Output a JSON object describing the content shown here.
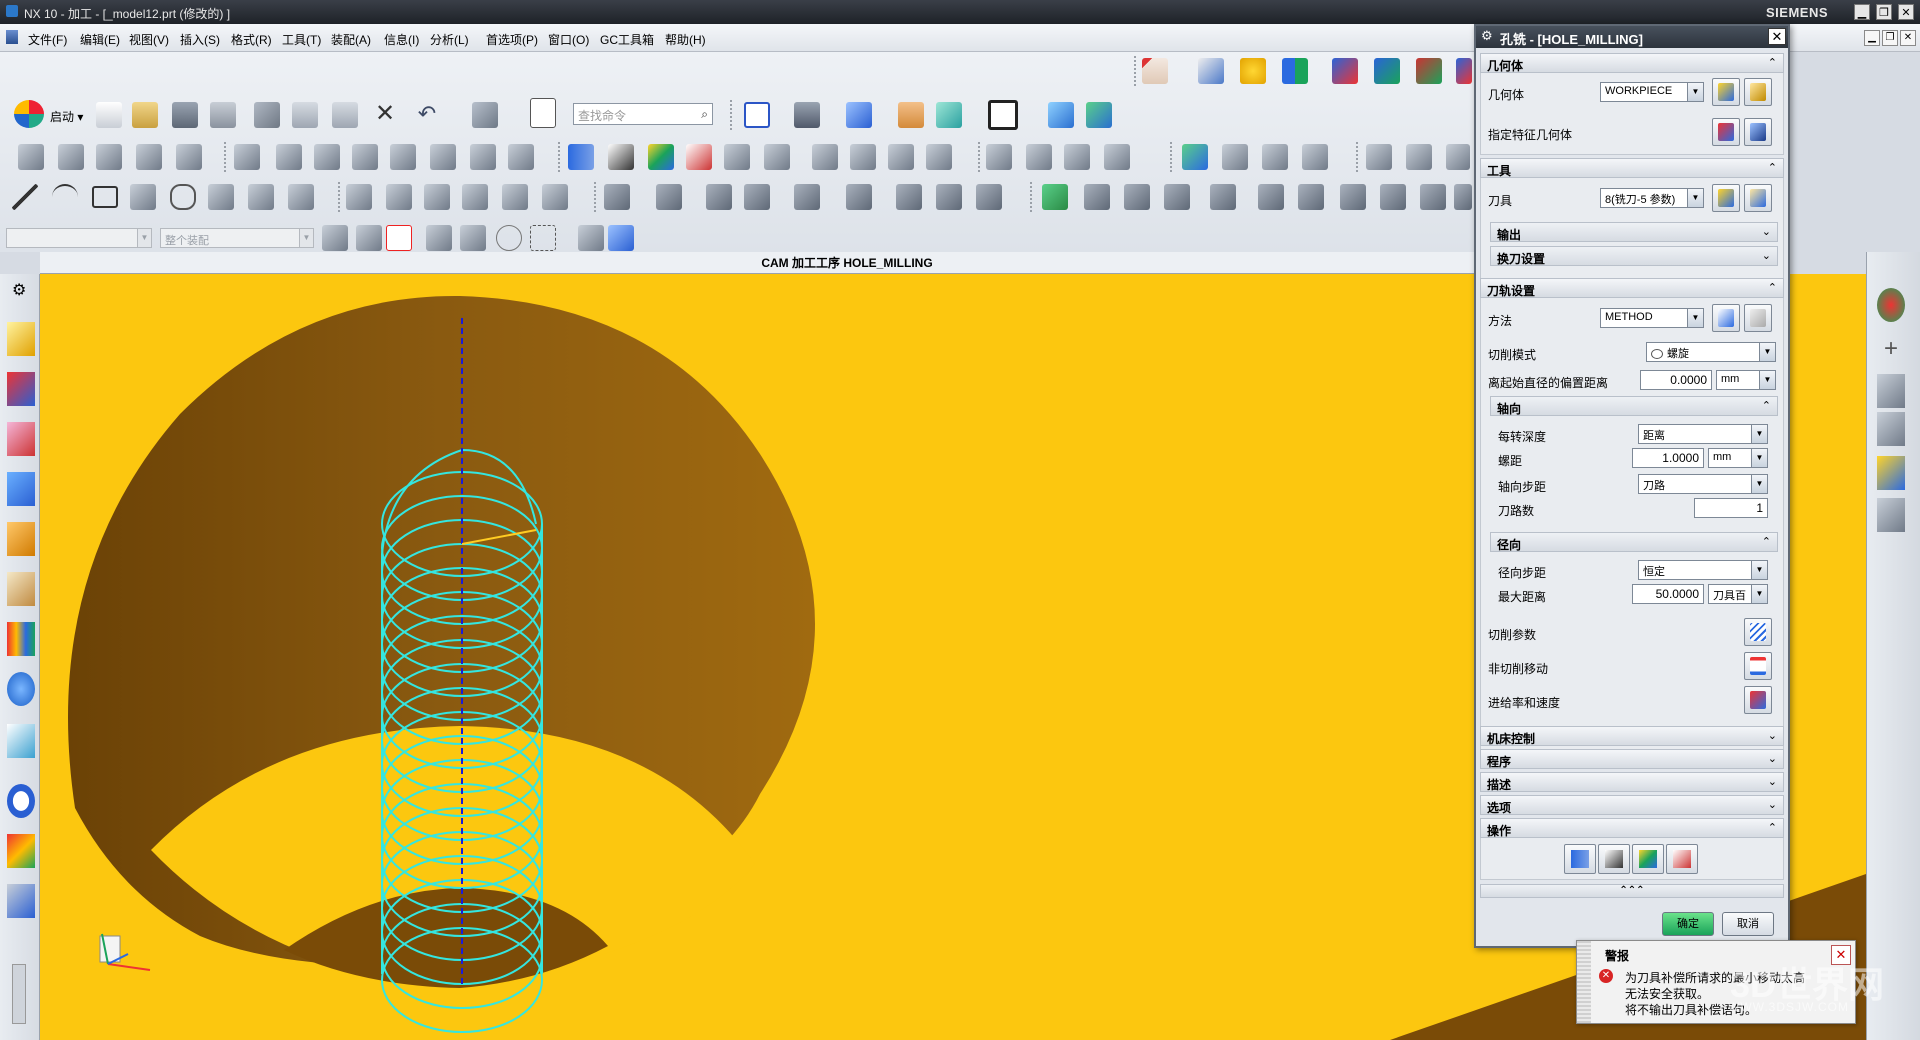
{
  "window": {
    "title": "NX 10 - 加工 - [_model12.prt  (修改的) ]",
    "brand": "SIEMENS",
    "minimize": "▁",
    "restore": "❐",
    "close": "✕"
  },
  "menu": {
    "items": [
      "文件(F)",
      "编辑(E)",
      "视图(V)",
      "插入(S)",
      "格式(R)",
      "工具(T)",
      "装配(A)",
      "信息(I)",
      "分析(L)",
      "首选项(P)",
      "窗口(O)",
      "GC工具箱",
      "帮助(H)"
    ]
  },
  "toolbar": {
    "start_label": "启动 ▾",
    "search_placeholder": "查找命令",
    "assembly_combo": "整个装配"
  },
  "viewport": {
    "title": "CAM 加工工序 HOLE_MILLING"
  },
  "dialog": {
    "title": "孔铣 - [HOLE_MILLING]",
    "geometry": {
      "header": "几何体",
      "geometry_label": "几何体",
      "geometry_value": "WORKPIECE",
      "feature_label": "指定特征几何体"
    },
    "tool": {
      "header": "工具",
      "tool_label": "刀具",
      "tool_value": "8(铣刀-5 参数)",
      "output_header": "输出",
      "toolchange_header": "换刀设置"
    },
    "path": {
      "header": "刀轨设置",
      "method_label": "方法",
      "method_value": "METHOD",
      "cut_mode_label": "切削模式",
      "cut_mode_value": "螺旋",
      "offset_label": "离起始直径的偏置距离",
      "offset_value": "0.0000",
      "offset_unit": "mm",
      "axial": {
        "header": "轴向",
        "depth_per_rev_label": "每转深度",
        "depth_per_rev_value": "距离",
        "pitch_label": "螺距",
        "pitch_value": "1.0000",
        "pitch_unit": "mm",
        "axial_step_label": "轴向步距",
        "axial_step_value": "刀路",
        "path_count_label": "刀路数",
        "path_count_value": "1"
      },
      "radial": {
        "header": "径向",
        "radial_step_label": "径向步距",
        "radial_step_value": "恒定",
        "max_dist_label": "最大距离",
        "max_dist_value": "50.0000",
        "max_dist_unit": "刀具百"
      },
      "cut_params_label": "切削参数",
      "non_cut_label": "非切削移动",
      "feeds_label": "进给率和速度"
    },
    "machine_header": "机床控制",
    "program_header": "程序",
    "description_header": "描述",
    "options_header": "选项",
    "actions_header": "操作",
    "more": "⌃⌃⌃",
    "ok": "确定",
    "cancel": "取消"
  },
  "warning": {
    "title": "警报",
    "line1": "为刀具补偿所请求的最小移动太高",
    "line2": "无法安全获取。",
    "line3": "将不输出刀具补偿语句。"
  },
  "watermark": {
    "text": "3D世界网",
    "url": "WWW.3DSJW.COM"
  },
  "colors": {
    "viewport_bg": "#fcc70f",
    "hole_wall": "#7a4b07",
    "toolpath": "#34e6e0",
    "axis_line": "#1a1ad8"
  }
}
